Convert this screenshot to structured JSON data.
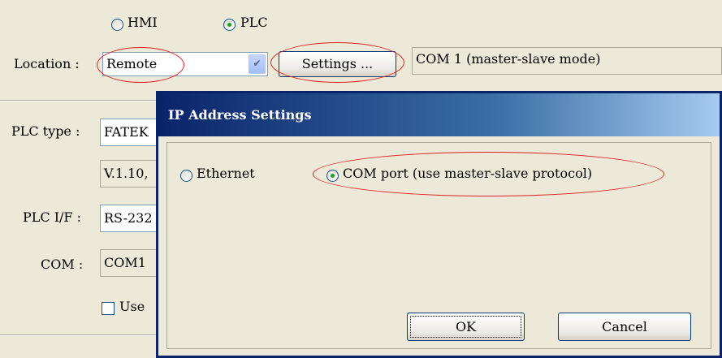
{
  "main": {
    "radio_hmi_label": "HMI",
    "radio_plc_label": "PLC",
    "location_label": "Location :",
    "location_value": "Remote",
    "settings_button": "Settings ...",
    "com_status": "COM 1 (master-slave mode)",
    "plc_type_label": "PLC type :",
    "plc_type_value": "FATEK",
    "version_value": "V.1.10,",
    "plc_if_label": "PLC I/F :",
    "plc_if_value": "RS-232",
    "com_label": "COM :",
    "com_value": "COM1",
    "use_checkbox_label": "Use"
  },
  "dialog": {
    "title": "IP Address Settings",
    "ethernet_label": "Ethernet",
    "com_port_label": "COM port (use master-slave protocol)",
    "ok_button": "OK",
    "cancel_button": "Cancel"
  },
  "colors": {
    "titlebar": "#0a246a",
    "annotation": "#e02020"
  }
}
